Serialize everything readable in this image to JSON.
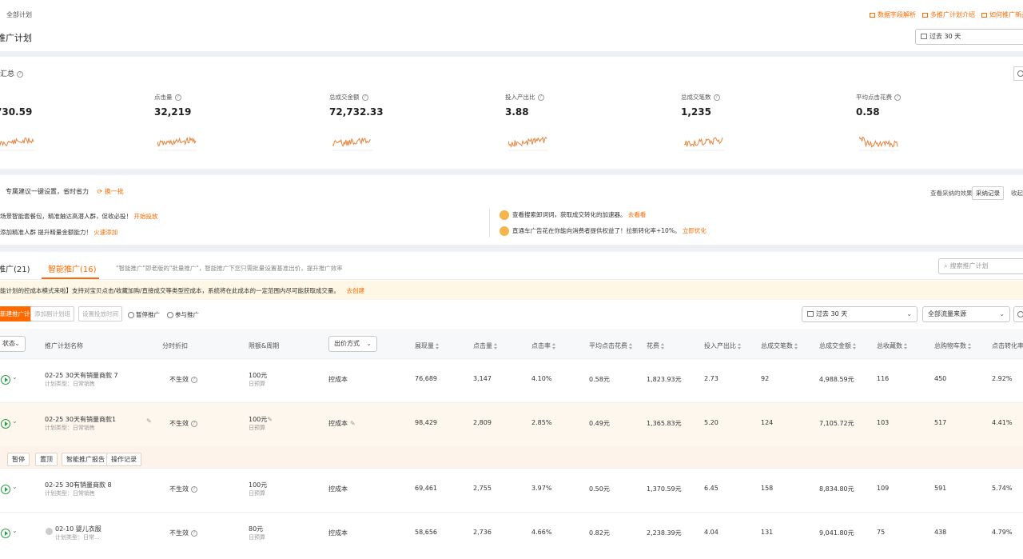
{
  "header": {
    "breadcrumb": "全部计划",
    "page_title": "推广计划",
    "links": [
      "数据字段解析",
      "多推广计划介绍",
      "如何推广新品"
    ],
    "date_range": "过去 30 天"
  },
  "summary": {
    "title": "汇总",
    "metrics": [
      {
        "label": "",
        "value": "730.59"
      },
      {
        "label": "点击量",
        "value": "32,219"
      },
      {
        "label": "总成交金额",
        "value": "72,732.33"
      },
      {
        "label": "投入产出比",
        "value": "3.88"
      },
      {
        "label": "总成交笔数",
        "value": "1,235"
      },
      {
        "label": "平均点击花费",
        "value": "0.58"
      }
    ]
  },
  "advice": {
    "title": "专属建议一键设置，省时省力",
    "refresh": "换一批",
    "history_label": "查看采纳的效果:",
    "history_btn": "采纳记录",
    "more": "收起",
    "items": [
      {
        "text": "场景智能套餐包，精准触达高潜人群，促收必投！",
        "action": "开始投放"
      },
      {
        "text": "添加精准人群  提升精量金额能力！",
        "action": "火速添加"
      },
      {
        "text": "查看搜索卸词词，获取成交转化的加速器。",
        "action": "去看看"
      },
      {
        "text": "直通车广告花在你能向消费者提供权益了！拉新转化率+10%。",
        "action": "立即优化"
      }
    ]
  },
  "tabs": {
    "tab1": "推广(21)",
    "tab2": "智能推广(16)",
    "desc": "\"智能推广\"即老版的\"批量推广\"，智能推广下您只需批量设置基准出价，提升推广效率",
    "search_placeholder": "搜索推广计划"
  },
  "notice": {
    "text": "能计划的控成本模式来啦】支持对宝贝点击/收藏加购/直接成交等类型控成本，系统将在此成本的一定范围内尽可能获取成交量。",
    "action": "去创建"
  },
  "toolbar": {
    "new_plan": "新建推广计划",
    "add_plan": "添加副计划组",
    "set_time": "设置投放时间",
    "pause": "暂停推广",
    "join": "参与推广",
    "date_range": "过去 30 天",
    "traffic": "全部流量来源"
  },
  "table": {
    "headers": [
      "状态",
      "推广计划名称",
      "分时折扣",
      "限额&周期",
      "出价方式",
      "展现量",
      "点击量",
      "点击率",
      "平均点击花费",
      "花费",
      "投入产出比",
      "总成交笔数",
      "总成交金额",
      "总收藏数",
      "总购物车数",
      "点击转化率"
    ],
    "rows": [
      {
        "name": "02-25 30天有销量商款 7",
        "type": "计划类型：日常销售",
        "discount": "不生效",
        "limit": "100元",
        "period": "日预算",
        "bid": "控成本",
        "imp": "76,689",
        "clicks": "3,147",
        "ctr": "4.10%",
        "cpc": "0.58元",
        "cost": "1,823.93元",
        "roi": "2.73",
        "orders": "92",
        "gmv": "4,988.59元",
        "fav": "116",
        "cart": "450",
        "cvr": "2.92%"
      },
      {
        "name": "02-25 30天有销量商款1",
        "type": "计划类型：日常销售",
        "discount": "不生效",
        "limit": "100元",
        "period": "日预算",
        "bid": "控成本",
        "imp": "98,429",
        "clicks": "2,809",
        "ctr": "2.85%",
        "cpc": "0.49元",
        "cost": "1,365.83元",
        "roi": "5.20",
        "orders": "124",
        "gmv": "7,105.72元",
        "fav": "103",
        "cart": "517",
        "cvr": "4.41%"
      },
      {
        "name": "02-25 30有销量商款 8",
        "type": "计划类型：日常销售",
        "discount": "不生效",
        "limit": "100元",
        "period": "日预算",
        "bid": "控成本",
        "imp": "69,461",
        "clicks": "2,755",
        "ctr": "3.97%",
        "cpc": "0.50元",
        "cost": "1,370.59元",
        "roi": "6.45",
        "orders": "158",
        "gmv": "8,834.80元",
        "fav": "109",
        "cart": "591",
        "cvr": "5.74%"
      },
      {
        "name": "02-10 婴儿衣服",
        "type": "计划类型：日常...",
        "discount": "不生效",
        "limit": "80元",
        "period": "日预算",
        "bid": "控成本",
        "imp": "58,656",
        "clicks": "2,736",
        "ctr": "4.66%",
        "cpc": "0.82元",
        "cost": "2,238.39元",
        "roi": "4.04",
        "orders": "131",
        "gmv": "9,041.80元",
        "fav": "75",
        "cart": "438",
        "cvr": "4.79%"
      }
    ],
    "row_ops": [
      "暂停",
      "置顶",
      "智能推广报告",
      "操作记录"
    ]
  },
  "colors": {
    "accent": "#ff6a00",
    "green": "#2aa04a",
    "highlight": "#fdf7ee",
    "notice_bg": "#fff7e6",
    "spark": "#e8833a"
  }
}
